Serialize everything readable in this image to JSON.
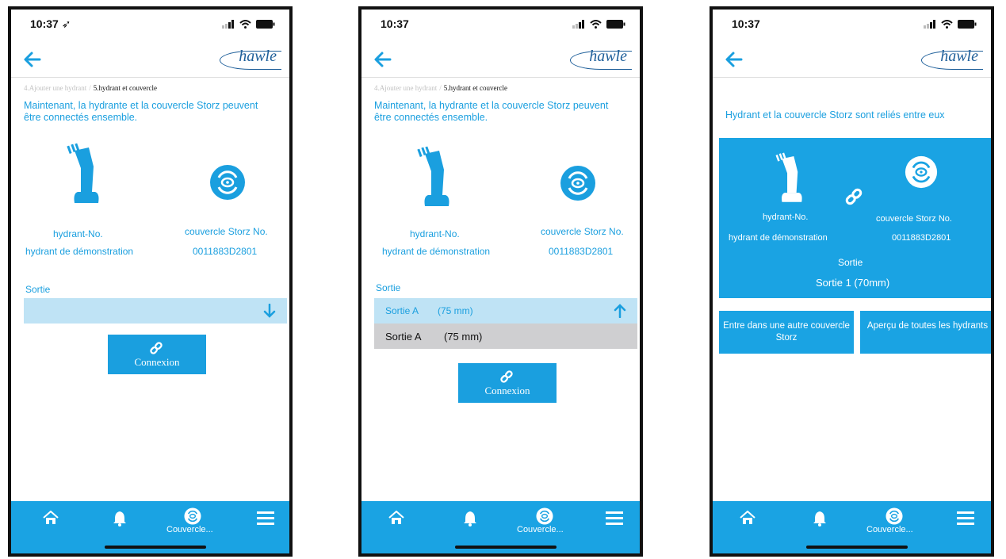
{
  "colors": {
    "accent": "#1aa3e3",
    "text_blue": "#1a9fdf",
    "logo": "#1e5f9a",
    "dropdown_bg": "#bfe3f5",
    "option_bg": "#cfcfd1"
  },
  "common": {
    "logo": "hawle",
    "hydrant_label": "hydrant-No.",
    "hydrant_value": "hydrant de démonstration",
    "cover_label": "couvercle Storz No.",
    "cover_value": "0011883D2801",
    "sortie_label": "Sortie",
    "connect_button": "Connexion",
    "tab_active_label": "Couvercle...",
    "icons": [
      "back-arrow-icon",
      "home-icon",
      "bell-icon",
      "storz-cover-icon",
      "menu-icon",
      "link-icon",
      "hydrant-icon"
    ]
  },
  "screen1": {
    "time": "10:37 ➶",
    "breadcrumb": {
      "previous": "4.Ajouter une hydrant",
      "current": "5.hydrant et couvercle"
    },
    "intro": "Maintenant, la hydrante et la couvercle Storz peuvent être connectés ensemble.",
    "dropdown_value": ""
  },
  "screen2": {
    "time": "10:37",
    "breadcrumb": {
      "previous": "4.Ajouter une hydrant",
      "current": "5.hydrant et couvercle"
    },
    "intro": "Maintenant, la hydrante et la couvercle Storz peuvent être connectés ensemble.",
    "dropdown_value": {
      "name": "Sortie A",
      "size": "(75 mm)"
    },
    "option": {
      "name": "Sortie A",
      "size": "(75 mm)"
    }
  },
  "screen3": {
    "time": "10:37",
    "message": "Hydrant et la couvercle Storz sont reliés entre eux",
    "sortie_value": "Sortie 1 (70mm)",
    "button_other": "Entre dans une autre couvercle Storz",
    "button_overview": "Aperçu de toutes les hydrants"
  }
}
